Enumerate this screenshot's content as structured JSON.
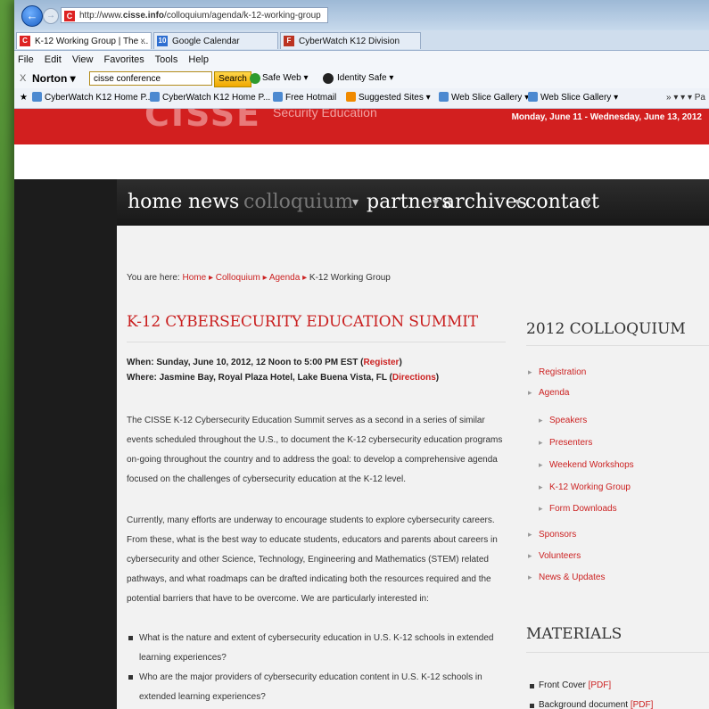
{
  "browser": {
    "url_prefix": "http://www.",
    "url_domain": "cisse.info",
    "url_path": "/colloquium/agenda/k-12-working-group",
    "tabs": [
      {
        "label": "K-12 Working Group | The ...",
        "close": "×"
      },
      {
        "label": "Google Calendar"
      },
      {
        "label": "CyberWatch K12 Division"
      }
    ],
    "menu": [
      "File",
      "Edit",
      "View",
      "Favorites",
      "Tools",
      "Help"
    ],
    "norton": {
      "close": "X",
      "brand": "Norton",
      "dropdown": "▾",
      "search_value": "cisse conference",
      "search_button": "Search",
      "safe_web": "Safe Web ▾",
      "identity_safe": "Identity Safe ▾"
    },
    "favorites": [
      "CyberWatch K12 Home P...",
      "CyberWatch K12 Home P...",
      "Free Hotmail",
      "Suggested Sites ▾",
      "Web Slice Gallery ▾",
      "Web Slice Gallery ▾"
    ],
    "toolbar_right": "» ▾ ▾ ▾ Pa"
  },
  "site": {
    "logo_fragment": "CISSE",
    "tagline_fragment": "Security Education",
    "dates": "Monday, June 11 - Wednesday, June 13, 2012",
    "nav": {
      "home": "home",
      "news": "news",
      "colloquium": "colloquium",
      "partners": "partners",
      "archives": "archives",
      "contact": "contact",
      "sep": "▾"
    },
    "breadcrumb": {
      "prefix": "You are here:",
      "home": "Home",
      "colloquium": "Colloquium",
      "agenda": "Agenda",
      "current": "K-12 Working Group",
      "sep": "▸"
    }
  },
  "main": {
    "title": "K-12 CYBERSECURITY EDUCATION SUMMIT",
    "when_text": "When: Sunday, June 10, 2012, 12 Noon to 5:00 PM EST (",
    "when_link": "Register",
    "where_text": "Where: Jasmine Bay, Royal Plaza Hotel, Lake Buena Vista, FL (",
    "where_link": "Directions",
    "close_paren": ")",
    "para1": "The CISSE K-12 Cybersecurity Education Summit serves as a second in a series of similar events scheduled throughout the U.S., to document the K-12 cybersecurity education programs on-going throughout the country and to address the goal: to develop a comprehensive agenda focused on the challenges of cybersecurity education at the K-12 level.",
    "para2": "Currently, many efforts are underway to encourage students to explore cybersecurity careers. From these, what is the best way to educate students, educators and parents about careers in cybersecurity and other Science, Technology, Engineering and Mathematics (STEM) related pathways, and what roadmaps can be drafted indicating both the resources required and the potential barriers that have to be overcome. We are particularly interested in:",
    "bullets": [
      "What is the nature and extent of cybersecurity education in U.S. K-12 schools in extended learning experiences?",
      "Who are the major providers of cybersecurity education content in U.S. K-12 schools in extended learning experiences?"
    ]
  },
  "sidebar": {
    "colloquium_title": "2012 COLLOQUIUM",
    "links": [
      "Registration",
      "Agenda"
    ],
    "agenda_sub": [
      "Speakers",
      "Presenters",
      "Weekend Workshops",
      "K-12 Working Group",
      "Form Downloads"
    ],
    "more_links": [
      "Sponsors",
      "Volunteers",
      "News & Updates"
    ],
    "materials_title": "MATERIALS",
    "materials": [
      {
        "label": "Front Cover ",
        "link": "[PDF]"
      },
      {
        "label": "Background document ",
        "link": "[PDF]"
      }
    ]
  }
}
